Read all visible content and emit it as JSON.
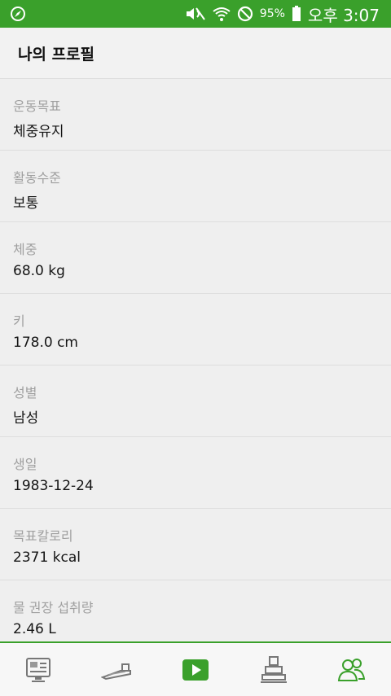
{
  "status_bar": {
    "battery": "95%",
    "time": "오후 3:07",
    "icons": [
      "compass-icon",
      "mute-icon",
      "wifi-icon",
      "do-not-disturb-icon",
      "battery-icon"
    ]
  },
  "header": {
    "title": "나의 프로필"
  },
  "profile": [
    {
      "label": "운동목표",
      "value": "체중유지"
    },
    {
      "label": "활동수준",
      "value": "보통"
    },
    {
      "label": "체중",
      "value": "68.0 kg"
    },
    {
      "label": "키",
      "value": "178.0 cm"
    },
    {
      "label": "성별",
      "value": "남성"
    },
    {
      "label": "생일",
      "value": "1983-12-24"
    },
    {
      "label": "목표칼로리",
      "value": "2371 kcal"
    },
    {
      "label": "물 권장 섭취량",
      "value": "2.46 L"
    }
  ],
  "nav": [
    "monitor-icon",
    "treadmill-icon",
    "play-icon",
    "trophy-icon",
    "profile-users-icon"
  ],
  "colors": {
    "accent": "#3aa02b",
    "background": "#efefef"
  }
}
